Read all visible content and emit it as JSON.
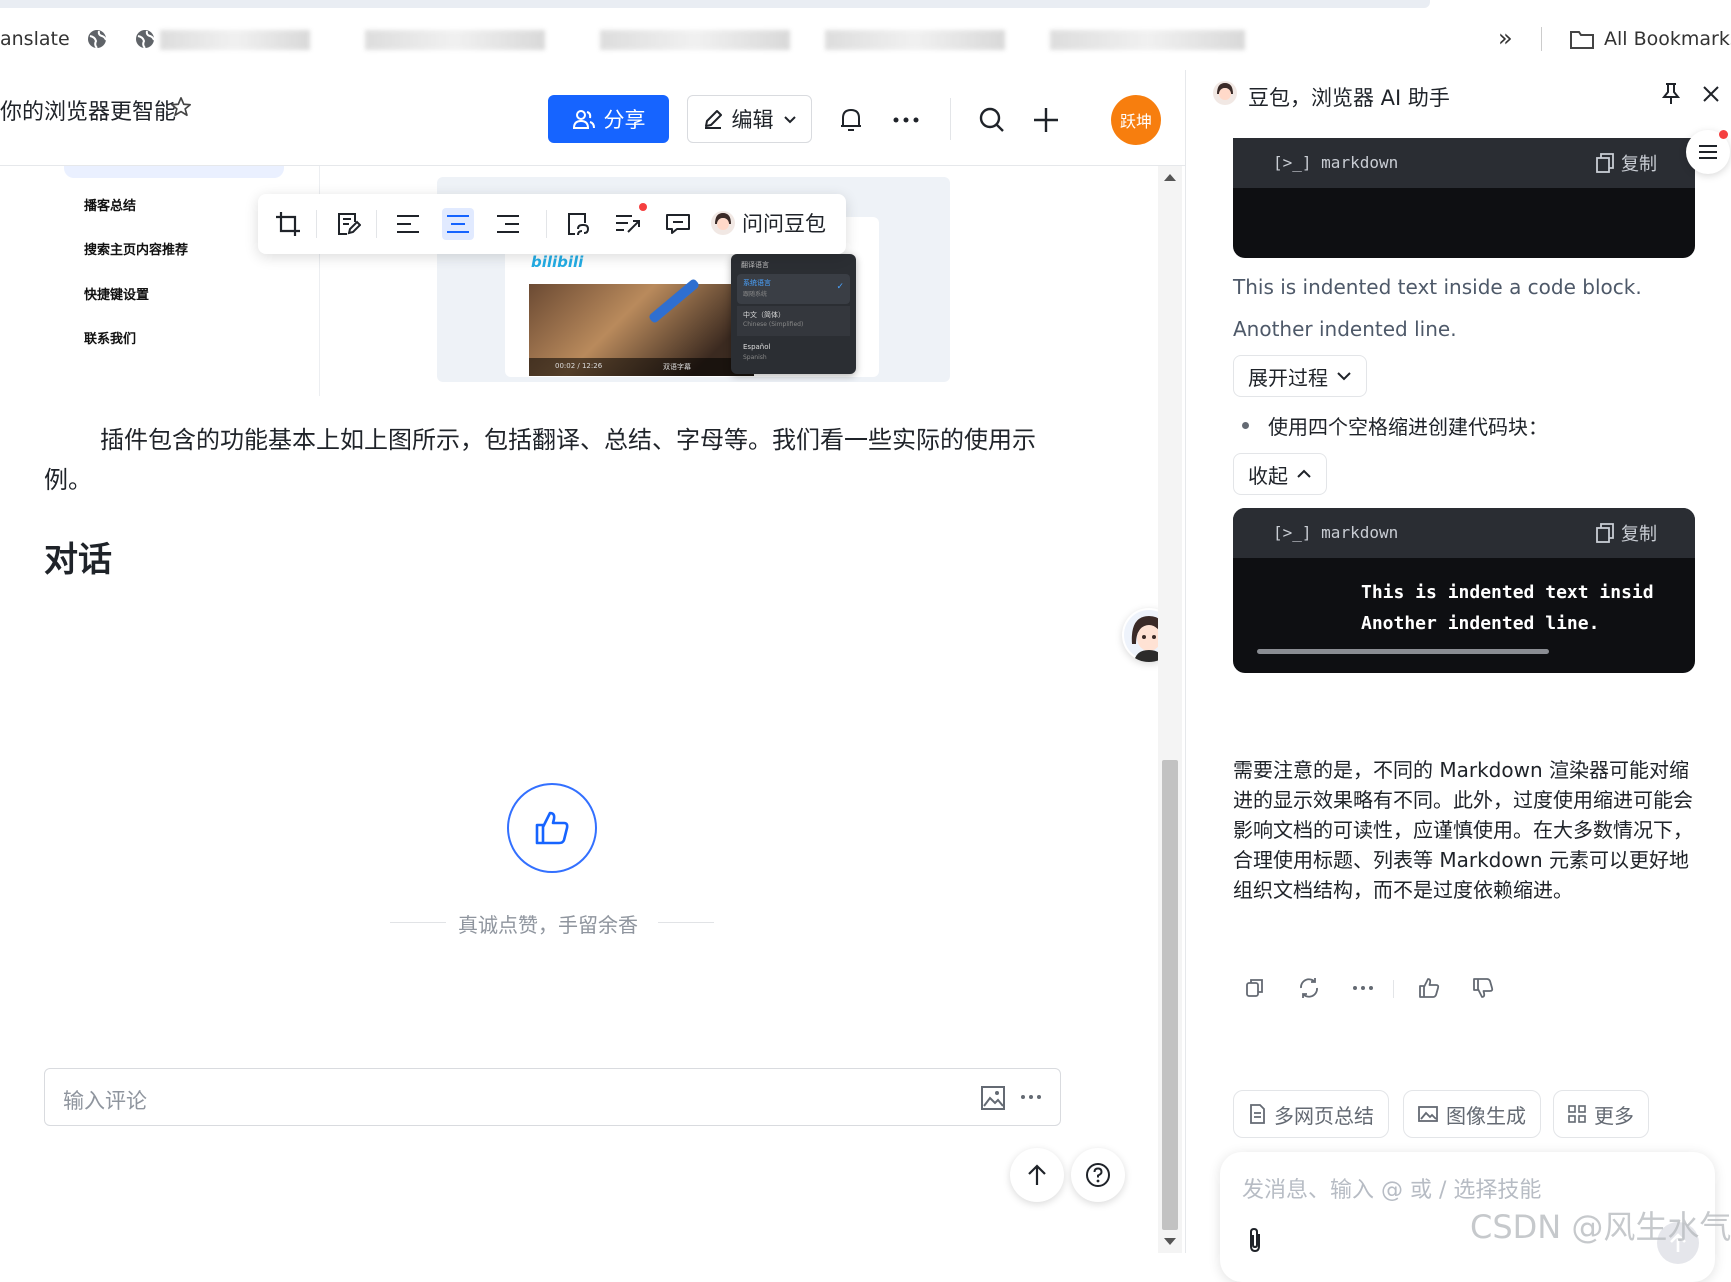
{
  "bookmarks": {
    "first_label": "anslate",
    "all_bookmarks_label": "All Bookmarks",
    "overflow_label": "»"
  },
  "doc": {
    "title": "你的浏览器更智能",
    "share_label": "分享",
    "edit_label": "编辑",
    "avatar_label": "跃坤",
    "nav_items": [
      "播客总结",
      "搜索主页内容推荐",
      "快捷键设置",
      "联系我们"
    ],
    "toolbar": {
      "ask_label": "问问豆包"
    },
    "paragraph": "插件包含的功能基本上如上图所示，包括翻译、总结、字母等。我们看一些实际的使用示例。",
    "heading": "对话",
    "like_caption": "真诚点赞，手留余香",
    "comment_placeholder": "输入评论",
    "preview": {
      "bili_logo": "bilibili",
      "menu_title": "翻译语言",
      "menu_items": [
        {
          "label": "系统语言",
          "sub": "跟随系统"
        },
        {
          "label": "中文（简体）",
          "sub": "Chinese (Simplified)"
        },
        {
          "label": "Español",
          "sub": "Spanish"
        }
      ],
      "time": "00:02 / 12:26",
      "subtitle_btn": "双语字幕"
    }
  },
  "panel": {
    "title": "豆包，浏览器 AI 助手",
    "code_lang": "markdown",
    "copy_label": "复制",
    "text_line_1": "This is indented text inside a code block.",
    "text_line_2": "Another indented line.",
    "expand_label": "展开过程",
    "bullet": "使用四个空格缩进创建代码块：",
    "collapse_label": "收起",
    "code_lines": [
      "This is indented text insid",
      "Another indented line."
    ],
    "note": "需要注意的是，不同的 Markdown 渲染器可能对缩进的显示效果略有不同。此外，过度使用缩进可能会影响文档的可读性，应谨慎使用。在大多数情况下，合理使用标题、列表等 Markdown 元素可以更好地组织文档结构，而不是过度依赖缩进。",
    "chips": [
      "多网页总结",
      "图像生成",
      "更多"
    ],
    "input_placeholder": "发消息、输入 @ 或 / 选择技能"
  },
  "watermark": "CSDN @风生水气",
  "colors": {
    "primary": "#1664ff",
    "avatar_bg": "#f77e0e",
    "code_bg": "#0e0f12",
    "code_head": "#2a2d33",
    "red_dot": "#f53f3f"
  }
}
